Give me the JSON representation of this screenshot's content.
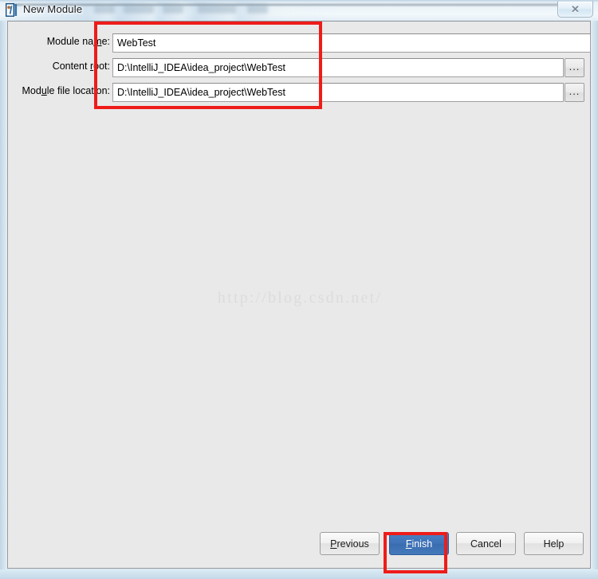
{
  "window": {
    "title": "New Module",
    "app_icon": "intellij-idea-icon",
    "close_label": "✕",
    "close_icon": "close-icon"
  },
  "form": {
    "rows": [
      {
        "label_pre": "Module na",
        "label_mnemonic": "m",
        "label_post": "e:",
        "value": "WebTest",
        "has_browse": false
      },
      {
        "label_pre": "Content ",
        "label_mnemonic": "r",
        "label_post": "oot:",
        "value": "D:\\IntelliJ_IDEA\\idea_project\\WebTest",
        "has_browse": true
      },
      {
        "label_pre": "Mod",
        "label_mnemonic": "u",
        "label_post": "le file location:",
        "value": "D:\\IntelliJ_IDEA\\idea_project\\WebTest",
        "has_browse": true
      }
    ],
    "browse_label": "..."
  },
  "watermark": {
    "text": "http://blog.csdn.net/"
  },
  "footer": {
    "buttons": [
      {
        "pre": "",
        "mnemonic": "P",
        "post": "revious",
        "primary": false
      },
      {
        "pre": "",
        "mnemonic": "F",
        "post": "inish",
        "primary": true
      },
      {
        "pre": "Cancel",
        "mnemonic": "",
        "post": "",
        "primary": false
      },
      {
        "pre": "Help",
        "mnemonic": "",
        "post": "",
        "primary": false
      }
    ]
  },
  "annotations": {
    "fields_box": "highlight-around-form-fields",
    "finish_box": "highlight-around-finish-button"
  },
  "colors": {
    "annotation_red": "#ee1c19",
    "primary_button_blue": "#3f72b7",
    "dialog_background": "#e9e9e9",
    "watermark_gray": "#dcdcdc"
  }
}
